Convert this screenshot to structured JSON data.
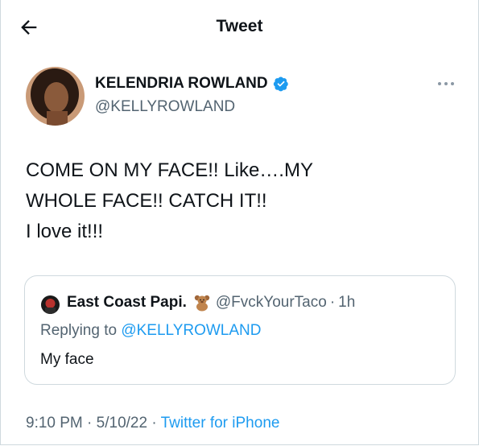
{
  "header": {
    "title": "Tweet",
    "back_icon": "arrow-left-icon"
  },
  "author": {
    "name": "KELENDRIA ROWLAND",
    "handle": "@KELLYROWLAND",
    "verified_icon": "verified-badge-icon",
    "verified_color": "#1d9bf0"
  },
  "tweet": {
    "text": "COME ON MY FACE!! Like….MY\nWHOLE FACE!! CATCH IT!!\nI love it!!!"
  },
  "quoted": {
    "name": "East Coast Papi.",
    "emoji": "🧸",
    "handle": "@FvckYourTaco",
    "separator": "·",
    "time": "1h",
    "replying_prefix": "Replying to",
    "replying_to": "@KELLYROWLAND",
    "text": "My face"
  },
  "meta": {
    "time": "9:10 PM",
    "separator1": "·",
    "date": "5/10/22",
    "separator2": "·",
    "source": "Twitter for iPhone"
  },
  "colors": {
    "accent": "#1d9bf0",
    "secondary_text": "#536471",
    "border": "#cfd9de"
  }
}
